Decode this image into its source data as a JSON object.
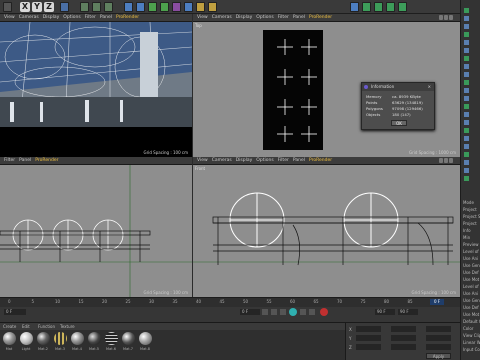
{
  "toolbar": {
    "axis_letters": [
      "X",
      "Y",
      "Z"
    ]
  },
  "viewports": {
    "perspective": {
      "menu": [
        "View",
        "Cameras",
        "Display",
        "Options",
        "Filter",
        "Panel",
        "ProRender"
      ]
    },
    "top": {
      "menu": [
        "View",
        "Cameras",
        "Display",
        "Options",
        "Filter",
        "Panel",
        "ProRender"
      ],
      "camera": "Top",
      "grid": "Grid Spacing : 1000 cm"
    },
    "right": {
      "menu": [
        "Filter",
        "Panel",
        "ProRender"
      ],
      "grid": "Grid Spacing : 100 cm"
    },
    "front": {
      "menu": [
        "View",
        "Cameras",
        "Display",
        "Options",
        "Filter",
        "Panel",
        "ProRender"
      ],
      "camera": "Front",
      "grid": "Grid Spacing : 100 cm"
    }
  },
  "perspective_grid": "Grid Spacing : 100 cm",
  "dialog": {
    "title": "Information",
    "rows": [
      {
        "label": "Memory",
        "value": "ca. 8939 KByte"
      },
      {
        "label": "Points",
        "value": "63629 (134819)"
      },
      {
        "label": "Polygons",
        "value": "97098 (129466)"
      },
      {
        "label": "Objects",
        "value": "180 (147)"
      }
    ],
    "ok_label": "OK"
  },
  "timeline": {
    "ticks": [
      "0",
      "5",
      "10",
      "15",
      "20",
      "25",
      "30",
      "35",
      "40",
      "45",
      "50",
      "55",
      "60",
      "65",
      "70",
      "75",
      "80",
      "85",
      "90"
    ],
    "frame_start": "0 F",
    "frame_field": "0 F",
    "frame_end": "90 F",
    "frame_current": "90 F",
    "current_frame_tag": "0 F"
  },
  "materials": {
    "tabs": [
      "Create",
      "Edit",
      "Function",
      "Texture"
    ],
    "labels": [
      "Mat",
      "Light",
      "Mat.2",
      "Mat.3",
      "Mat.4",
      "Mat.5",
      "Mat.6",
      "Mat.7",
      "Mat.8",
      "Mat.9"
    ]
  },
  "attributes": {
    "rows": [
      "X",
      "Y",
      "Z"
    ],
    "apply_label": "Apply"
  },
  "right_panel": {
    "items": [
      "Mode",
      "Project",
      "Project Se",
      "Project",
      "Info",
      "Min",
      "Preview",
      "Level of",
      "Use Ani",
      "Use Gen",
      "Use Def",
      "Use Mot",
      "Level of",
      "Use Ani",
      "Use Gen",
      "Use Def",
      "Use Mot",
      "Default Ob",
      "Color",
      "View Clip",
      "Linear Wor",
      "Input Col"
    ]
  }
}
